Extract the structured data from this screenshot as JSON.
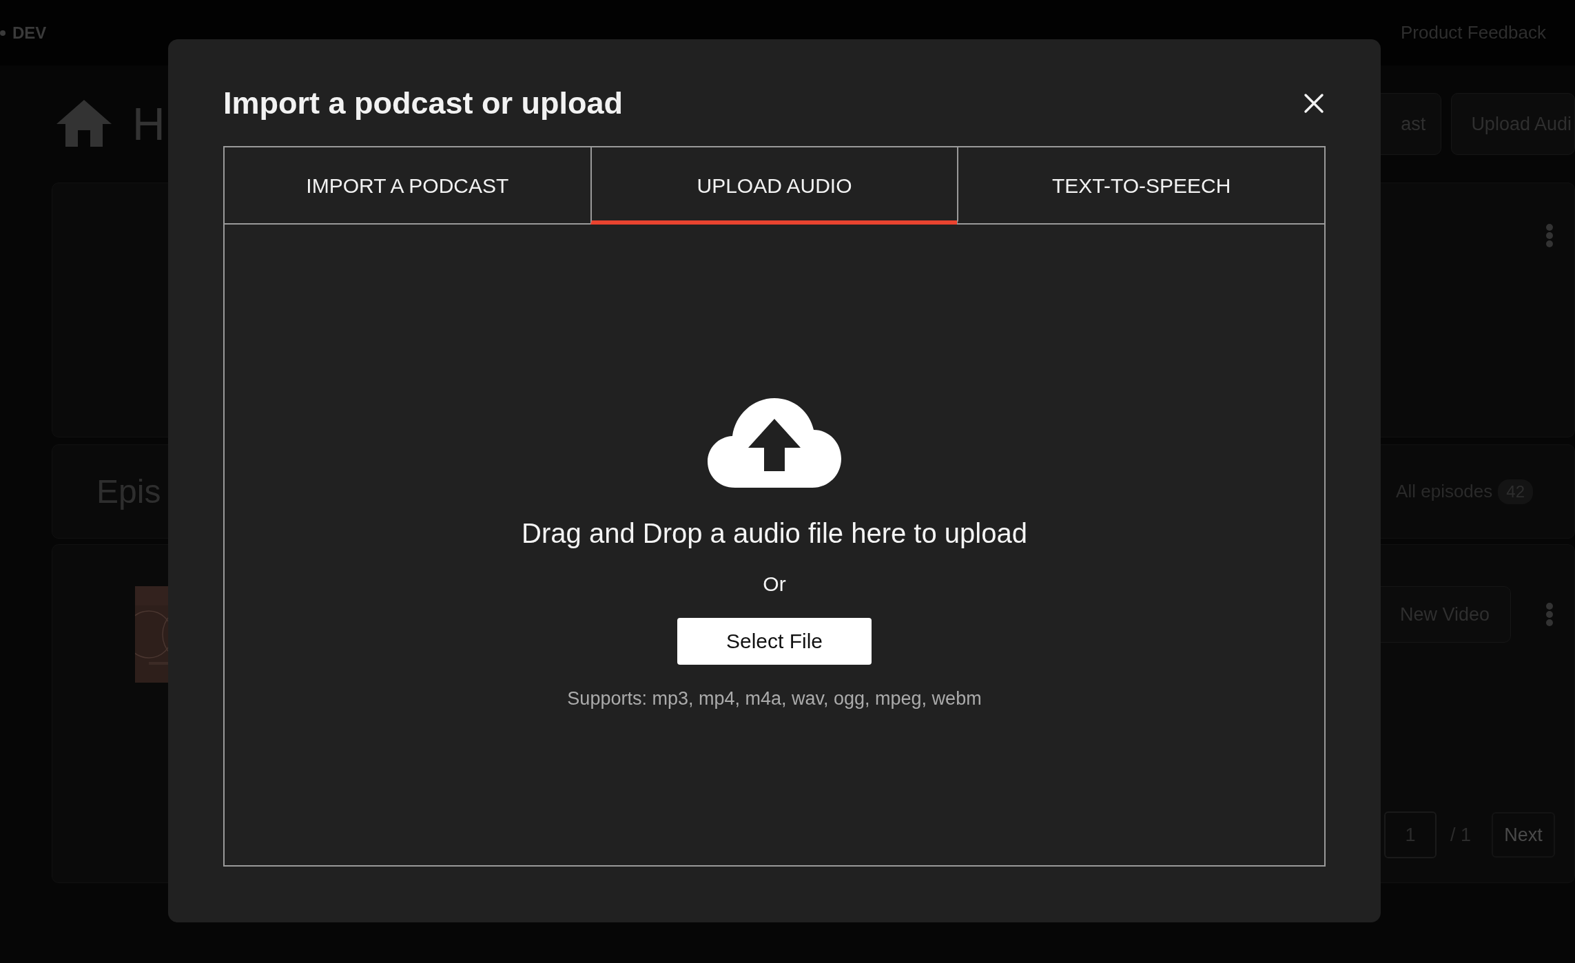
{
  "background": {
    "top_bar": {
      "badge": "DEV",
      "link": "Product Feedback"
    },
    "header": {
      "title": "H",
      "buttons": [
        "ast",
        "Upload Audi"
      ]
    },
    "episodes": {
      "title": "Epis",
      "filter": "All episodes",
      "count": "42"
    },
    "episode_row": {
      "button": "New Video"
    },
    "pagination": {
      "page": "1",
      "total": "/ 1",
      "next": "Next"
    }
  },
  "dialog": {
    "title": "Import a podcast or upload",
    "tabs": [
      {
        "label": "IMPORT A PODCAST",
        "selected": false
      },
      {
        "label": "UPLOAD AUDIO",
        "selected": true
      },
      {
        "label": "TEXT-TO-SPEECH",
        "selected": false
      }
    ],
    "dropzone": {
      "message": "Drag and Drop a audio file here to upload",
      "separator": "Or",
      "button": "Select File",
      "note": "Supports: mp3, mp4, m4a, wav, ogg, mpeg, webm"
    }
  }
}
